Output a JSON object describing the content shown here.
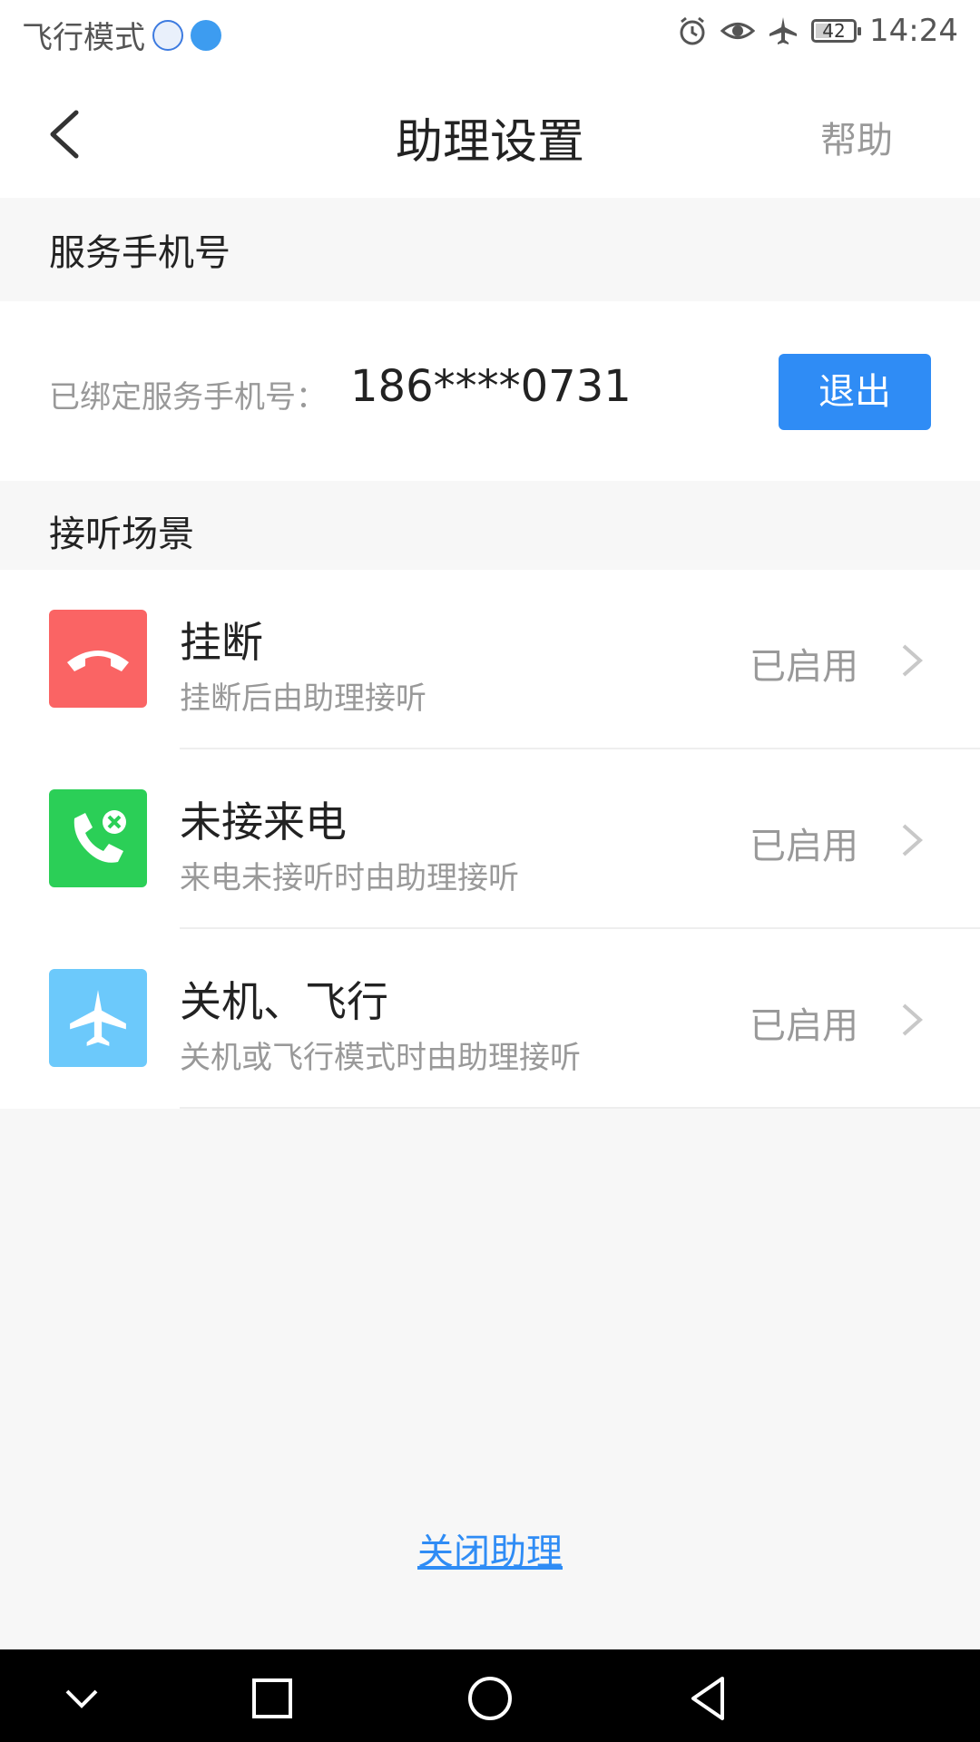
{
  "status_bar": {
    "mode_text": "飞行模式",
    "time": "14:24",
    "battery_level": "42",
    "icons": [
      "baidu-icon",
      "alipay-icon",
      "alarm-icon",
      "eye-icon",
      "airplane-icon",
      "battery-icon"
    ]
  },
  "header": {
    "title": "助理设置",
    "help": "帮助"
  },
  "service_phone": {
    "section_title": "服务手机号",
    "label": "已绑定服务手机号：",
    "number": "186****0731",
    "logout": "退出"
  },
  "scenes": {
    "section_title": "接听场景",
    "items": [
      {
        "title": "挂断",
        "desc": "挂断后由助理接听",
        "status": "已启用",
        "icon": "hang-up-icon",
        "color": "#fa6464"
      },
      {
        "title": "未接来电",
        "desc": "来电未接听时由助理接听",
        "status": "已启用",
        "icon": "missed-call-icon",
        "color": "#2bcf57"
      },
      {
        "title": "关机、飞行",
        "desc": "关机或飞行模式时由助理接听",
        "status": "已启用",
        "icon": "airplane-icon",
        "color": "#6cc9fb"
      }
    ]
  },
  "footer": {
    "close_assistant": "关闭助理"
  },
  "colors": {
    "accent": "#2f8cf5",
    "background": "#f7f7f7"
  }
}
